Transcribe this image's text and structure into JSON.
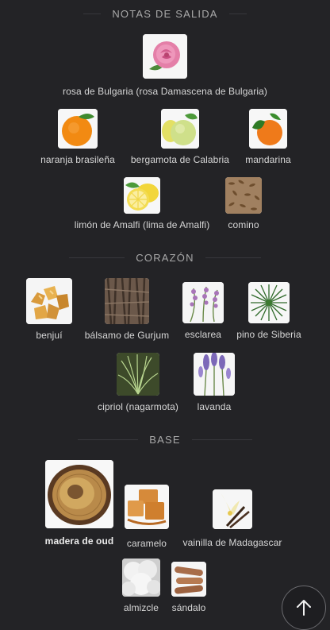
{
  "sections": {
    "top": {
      "title": "NOTAS DE SALIDA",
      "notes": [
        {
          "label": "rosa de Bulgaria (rosa Damascena de Bulgaria)",
          "icon": "rose-icon"
        },
        {
          "label": "naranja brasileña",
          "icon": "orange-icon"
        },
        {
          "label": "bergamota de Calabria",
          "icon": "bergamot-icon"
        },
        {
          "label": "mandarina",
          "icon": "mandarin-icon"
        },
        {
          "label": "limón de Amalfi (lima de Amalfi)",
          "icon": "lemon-icon"
        },
        {
          "label": "comino",
          "icon": "cumin-icon"
        }
      ]
    },
    "heart": {
      "title": "CORAZÓN",
      "notes": [
        {
          "label": "benjuí",
          "icon": "benzoin-icon"
        },
        {
          "label": "bálsamo de Gurjum",
          "icon": "bark-icon"
        },
        {
          "label": "esclarea",
          "icon": "clary-sage-icon"
        },
        {
          "label": "pino de Siberia",
          "icon": "pine-icon"
        },
        {
          "label": "cipriol (nagarmota)",
          "icon": "cypriol-icon"
        },
        {
          "label": "lavanda",
          "icon": "lavender-icon"
        }
      ]
    },
    "base": {
      "title": "BASE",
      "notes": [
        {
          "label": "madera de oud",
          "icon": "oud-wood-icon"
        },
        {
          "label": "caramelo",
          "icon": "caramel-icon"
        },
        {
          "label": "vainilla de Madagascar",
          "icon": "vanilla-icon"
        },
        {
          "label": "almizcle",
          "icon": "musk-icon"
        },
        {
          "label": "sándalo",
          "icon": "sandalwood-icon"
        }
      ]
    }
  },
  "scroll_top": {
    "icon": "arrow-up-icon"
  }
}
